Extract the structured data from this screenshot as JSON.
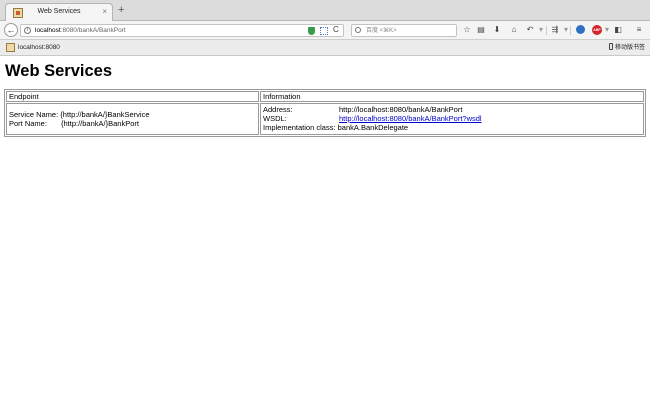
{
  "browser": {
    "tab": {
      "title": "Web Services"
    },
    "new_tab_label": "+",
    "close_tab_label": "×",
    "url": {
      "host": "localhost",
      "rest": ":8080/bankA/BankPort"
    },
    "search_placeholder": "百度 <⌘K>",
    "bookmarks": [
      {
        "label": "localhost:8080"
      }
    ],
    "mobile_bookmarks_label": "移动版书签"
  },
  "page": {
    "title": "Web Services",
    "table": {
      "headers": {
        "endpoint": "Endpoint",
        "information": "Information"
      },
      "endpoint": {
        "service_name_label": "Service Name:",
        "service_name": "{http://bankA/}BankService",
        "port_name_label": "Port Name:",
        "port_name": "{http://bankA/}BankPort"
      },
      "information": {
        "address_label": "Address:",
        "address": "http://localhost:8080/bankA/BankPort",
        "wsdl_label": "WSDL:",
        "wsdl": "http://localhost:8080/bankA/BankPort?wsdl",
        "impl_label": "Implementation class:",
        "impl": "bankA.BankDelegate"
      }
    }
  },
  "colors": {
    "link": "#0000cc",
    "tab_strip": "#dcdcdc",
    "toolbar": "#f4f4f4"
  }
}
